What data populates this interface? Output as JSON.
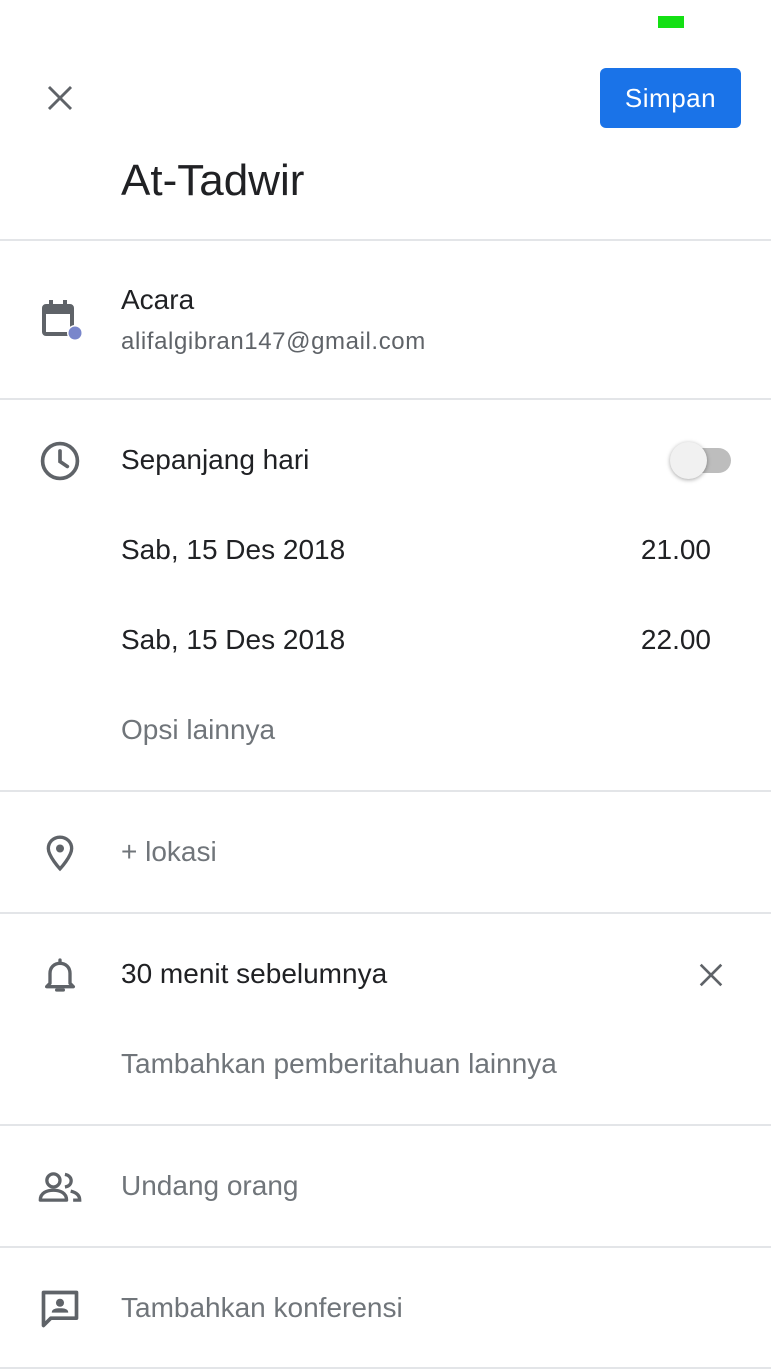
{
  "header": {
    "save_label": "Simpan",
    "title": "At-Tadwir"
  },
  "calendar": {
    "type_label": "Acara",
    "account": "alifalgibran147@gmail.com"
  },
  "time": {
    "all_day_label": "Sepanjang hari",
    "all_day_on": false,
    "start_date": "Sab, 15 Des 2018",
    "start_time": "21.00",
    "end_date": "Sab, 15 Des 2018",
    "end_time": "22.00",
    "more_options": "Opsi lainnya"
  },
  "location": {
    "placeholder": "+ lokasi"
  },
  "notifications": {
    "current": "30 menit sebelumnya",
    "add_more": "Tambahkan pemberitahuan lainnya"
  },
  "guests": {
    "label": "Undang orang"
  },
  "conference": {
    "label": "Tambahkan konferensi"
  },
  "colors": {
    "accent": "#1a73e8",
    "calendar_dot": "#7986cb",
    "status_indicator": "#14e014"
  },
  "icons": {
    "close": "close-icon",
    "calendar": "calendar-icon",
    "clock": "clock-icon",
    "location": "location-pin-icon",
    "notification": "bell-icon",
    "guests": "people-icon",
    "conference": "conference-icon"
  }
}
